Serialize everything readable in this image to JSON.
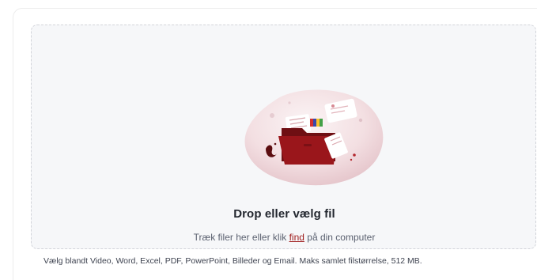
{
  "upload": {
    "title": "Drop eller vælg fil",
    "subtitle_before": "Træk filer her eller klik",
    "find_link": "find",
    "subtitle_after": "på din computer",
    "footnote": "Vælg blandt Video, Word, Excel, PDF, PowerPoint, Billeder og Email. Maks samlet filstørrelse, 512 MB."
  },
  "illustration": {
    "icon": "folder-with-documents-icon",
    "colors": {
      "accent": "#8e1418",
      "blob_light": "#f8eef0",
      "blob_dark": "#e8c9cf"
    }
  }
}
